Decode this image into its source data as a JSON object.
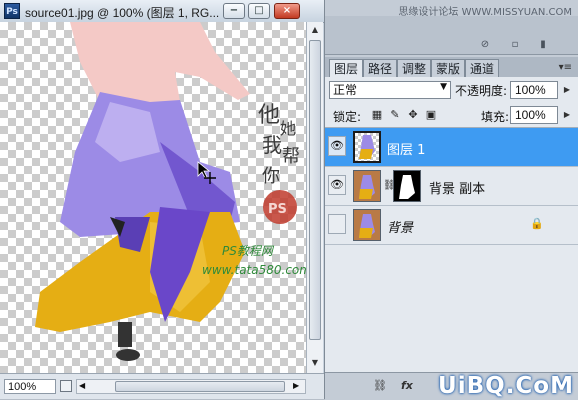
{
  "document": {
    "title": "source01.jpg @ 100% (图层 1, RG...",
    "window_buttons": [
      "−",
      "□",
      "×"
    ],
    "canvas": {
      "calligraphy": [
        "他",
        "她",
        "我",
        "帮",
        "你"
      ],
      "seal_text": "PS",
      "watermark_line1": "PS教程网",
      "watermark_line2": "www.tata580.com"
    },
    "status": {
      "zoom": "100%"
    }
  },
  "site_watermark_top": "思缘设计论坛 WWW.MISSYUAN.COM",
  "layers_panel": {
    "tabs": [
      {
        "label": "图层",
        "active": true
      },
      {
        "label": "路径",
        "active": false
      },
      {
        "label": "调整",
        "active": false
      },
      {
        "label": "蒙版",
        "active": false
      },
      {
        "label": "通道",
        "active": false
      }
    ],
    "blend_mode": "正常",
    "opacity_label": "不透明度:",
    "opacity_value": "100%",
    "lock_label": "锁定:",
    "fill_label": "填充:",
    "fill_value": "100%",
    "layers": [
      {
        "name": "图层 1",
        "visible": true,
        "selected": true,
        "thumb": "transparent-figure",
        "has_mask": false,
        "locked": false
      },
      {
        "name": "背景 副本",
        "visible": true,
        "selected": false,
        "thumb": "photo",
        "has_mask": true,
        "locked": false
      },
      {
        "name": "背景",
        "visible": false,
        "selected": false,
        "thumb": "photo",
        "has_mask": false,
        "locked": true
      }
    ]
  },
  "site_watermark_bottom": "UiBQ.CoM",
  "colors": {
    "selection_blue": "#3e9bf2",
    "seal_red": "#c0392b",
    "skirt_purple": "#8f7be0",
    "skirt_yellow": "#e9b21a",
    "watermark_green": "#2f8a3a"
  }
}
